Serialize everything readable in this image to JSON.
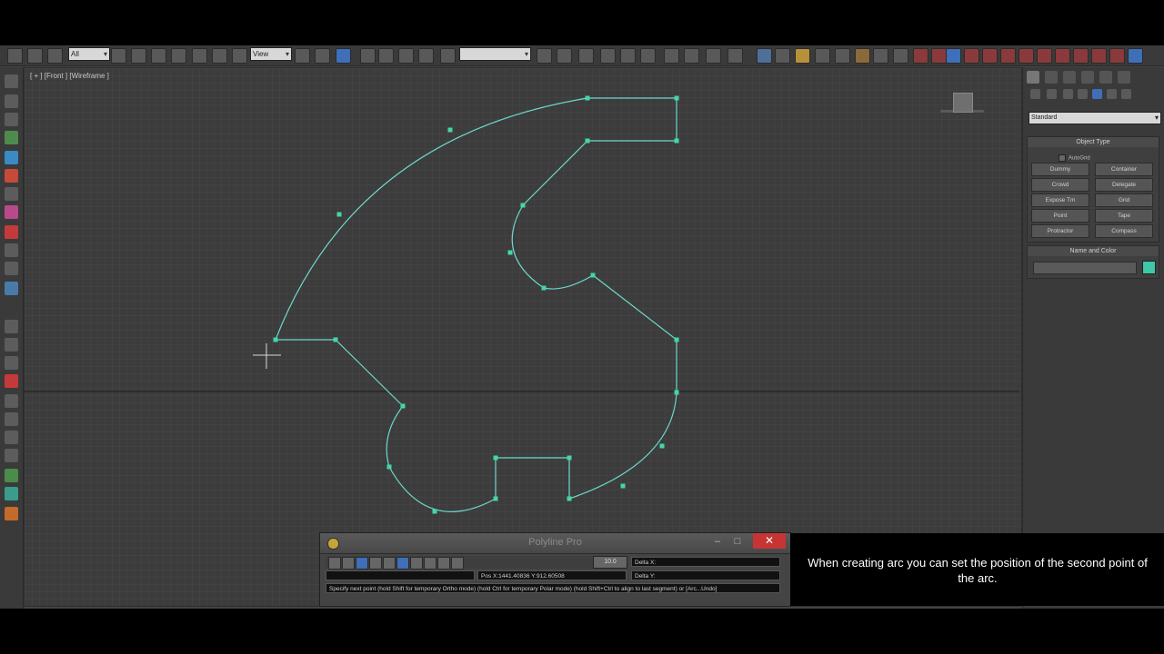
{
  "toolbar": {
    "selection_filter": "All",
    "reference_coord": "View",
    "named_selection": ""
  },
  "viewport": {
    "label": "[ + ] [Front ] [Wireframe ]"
  },
  "command_panel": {
    "category_dropdown": "Standard",
    "object_type_header": "Object Type",
    "autogrid_label": "AutoGrid",
    "object_buttons": [
      "Dummy",
      "Container",
      "Crowd",
      "Delegate",
      "Expose Tm",
      "Grid",
      "Point",
      "Tape",
      "Protractor",
      "Compass"
    ],
    "name_color_header": "Name and Color",
    "object_color": "#3ec8a8"
  },
  "spline": {
    "color": "#6ed8cc",
    "vertex_color": "#43d7a4"
  },
  "dialog": {
    "title": "Polyline Pro",
    "precision": "10.0",
    "delta_x": "Delta X:",
    "delta_y": "Delta Y:",
    "position": "Pos X:1441.40836   Y:912.60508",
    "prompt": "Specify next point (hold Shift for temporary Ortho mode) (hold Ctrl for temporary Polar mode) (hold Shift+Ctrl to align to last segment) or [Arc...Undo]",
    "minimize": "–",
    "maximize": "□",
    "close": "✕"
  },
  "caption": {
    "text": "When creating arc you can set the position of the second point of the arc."
  }
}
